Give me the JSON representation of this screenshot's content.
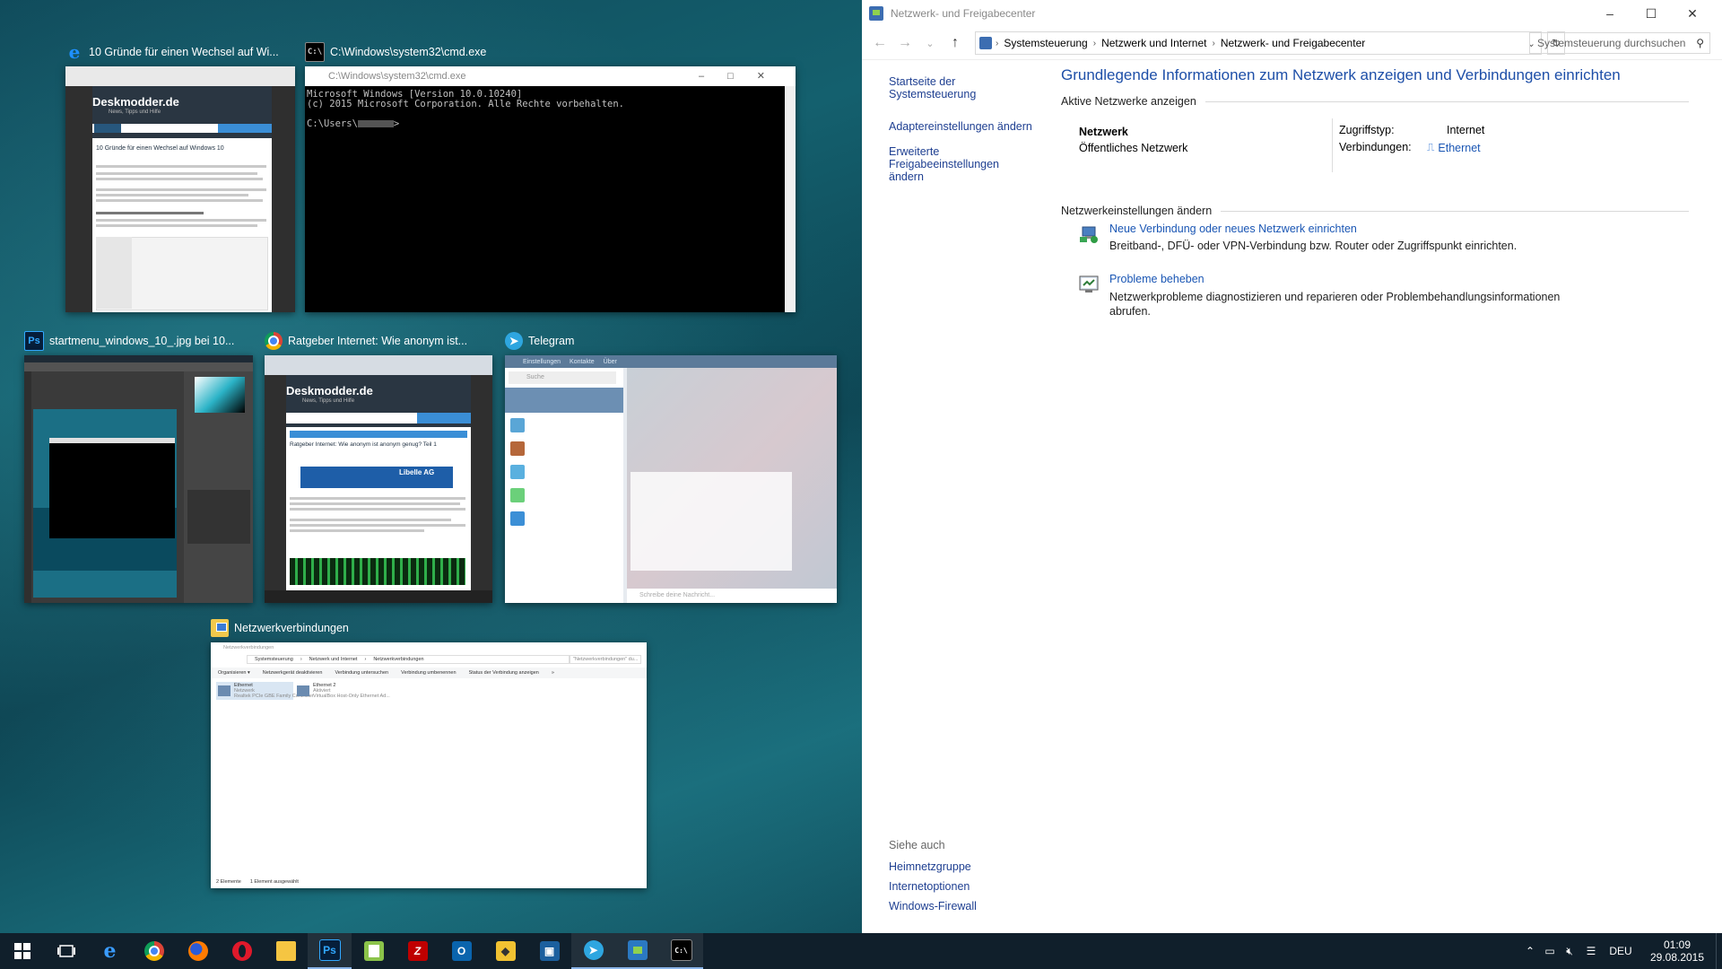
{
  "taskview": {
    "windows": [
      {
        "title": "10 Gründe für einen Wechsel auf Wi...",
        "icon": "edge-icon"
      },
      {
        "title": "C:\\Windows\\system32\\cmd.exe",
        "icon": "cmd-icon"
      },
      {
        "title": "startmenu_windows_10_.jpg bei 10...",
        "icon": "photoshop-icon"
      },
      {
        "title": "Ratgeber Internet: Wie anonym ist...",
        "icon": "chrome-icon"
      },
      {
        "title": "Telegram",
        "icon": "telegram-icon"
      },
      {
        "title": "Netzwerkverbindungen",
        "icon": "network-connections-icon"
      }
    ],
    "edge_thumb": {
      "site": "Deskmodder.de",
      "tagline": "News, Tipps und Hilfe",
      "headline": "10 Gründe für einen Wechsel auf Windows 10"
    },
    "cmd_thumb": {
      "window_title": "C:\\Windows\\system32\\cmd.exe",
      "line1": "Microsoft Windows [Version 10.0.10240]",
      "line2": "(c) 2015 Microsoft Corporation. Alle Rechte vorbehalten.",
      "prompt": "C:\\Users\\"
    },
    "chrome_thumb": {
      "site": "Deskmodder.de",
      "tagline": "News, Tipps und Hilfe",
      "headline": "Ratgeber Internet: Wie anonym ist anonym genug? Teil 1",
      "ad": "Libelle AG"
    },
    "telegram_thumb": {
      "menu": [
        "Einstellungen",
        "Kontakte",
        "Über"
      ],
      "search": "Suche",
      "input": "Schreibe deine Nachricht..."
    },
    "netconn_thumb": {
      "title": "Netzwerkverbindungen",
      "path": [
        "Systemsteuerung",
        "Netzwerk und Internet",
        "Netzwerkverbindungen"
      ],
      "search": "\"Netzwerkverbindungen\" du...",
      "toolbar": [
        "Organisieren ▾",
        "Netzwerkgerät deaktivieren",
        "Verbindung untersuchen",
        "Verbindung umbenennen",
        "Status der Verbindung anzeigen",
        "»"
      ],
      "adapters": [
        {
          "name": "Ethernet",
          "status": "Netzwerk",
          "device": "Realtek PCIe GBE Family Controller"
        },
        {
          "name": "Ethernet 2",
          "status": "Aktiviert",
          "device": "VirtualBox Host-Only Ethernet Ad..."
        }
      ],
      "status_left": "2 Elemente",
      "status_right": "1 Element ausgewählt"
    }
  },
  "control_panel": {
    "window_title": "Netzwerk- und Freigabecenter",
    "breadcrumb": [
      "Systemsteuerung",
      "Netzwerk und Internet",
      "Netzwerk- und Freigabecenter"
    ],
    "search_placeholder": "Systemsteuerung durchsuchen",
    "left_links": [
      "Startseite der Systemsteuerung",
      "Adaptereinstellungen ändern",
      "Erweiterte Freigabeeinstellungen ändern"
    ],
    "heading": "Grundlegende Informationen zum Netzwerk anzeigen und Verbindungen einrichten",
    "active_networks_label": "Aktive Netzwerke anzeigen",
    "network_name": "Netzwerk",
    "network_type": "Öffentliches Netzwerk",
    "access_type_label": "Zugriffstyp:",
    "access_type_value": "Internet",
    "connections_label": "Verbindungen:",
    "connections_value": "Ethernet",
    "change_settings_label": "Netzwerkeinstellungen ändern",
    "tasks": [
      {
        "link": "Neue Verbindung oder neues Netzwerk einrichten",
        "desc": "Breitband-, DFÜ- oder VPN-Verbindung bzw. Router oder Zugriffspunkt einrichten.",
        "icon": "new-connection-icon"
      },
      {
        "link": "Probleme beheben",
        "desc": "Netzwerkprobleme diagnostizieren und reparieren oder Problembehandlungsinformationen abrufen.",
        "icon": "troubleshoot-icon"
      }
    ],
    "see_also_label": "Siehe auch",
    "see_also": [
      "Heimnetzgruppe",
      "Internetoptionen",
      "Windows-Firewall"
    ]
  },
  "taskbar": {
    "apps": [
      "start-icon",
      "taskview-icon",
      "edge-icon",
      "chrome-icon",
      "firefox-icon",
      "opera-icon",
      "explorer-icon",
      "photoshop-icon",
      "notepadpp-icon",
      "filezilla-icon",
      "outlook-icon",
      "keepass-icon",
      "virtualbox-icon",
      "telegram-icon",
      "control-panel-icon",
      "cmd-icon"
    ],
    "language": "DEU",
    "time": "01:09",
    "date": "29.08.2015"
  },
  "colors": {
    "accent": "#1a56b4",
    "taskbar": "#101f2b",
    "heading": "#1e4fa8"
  }
}
